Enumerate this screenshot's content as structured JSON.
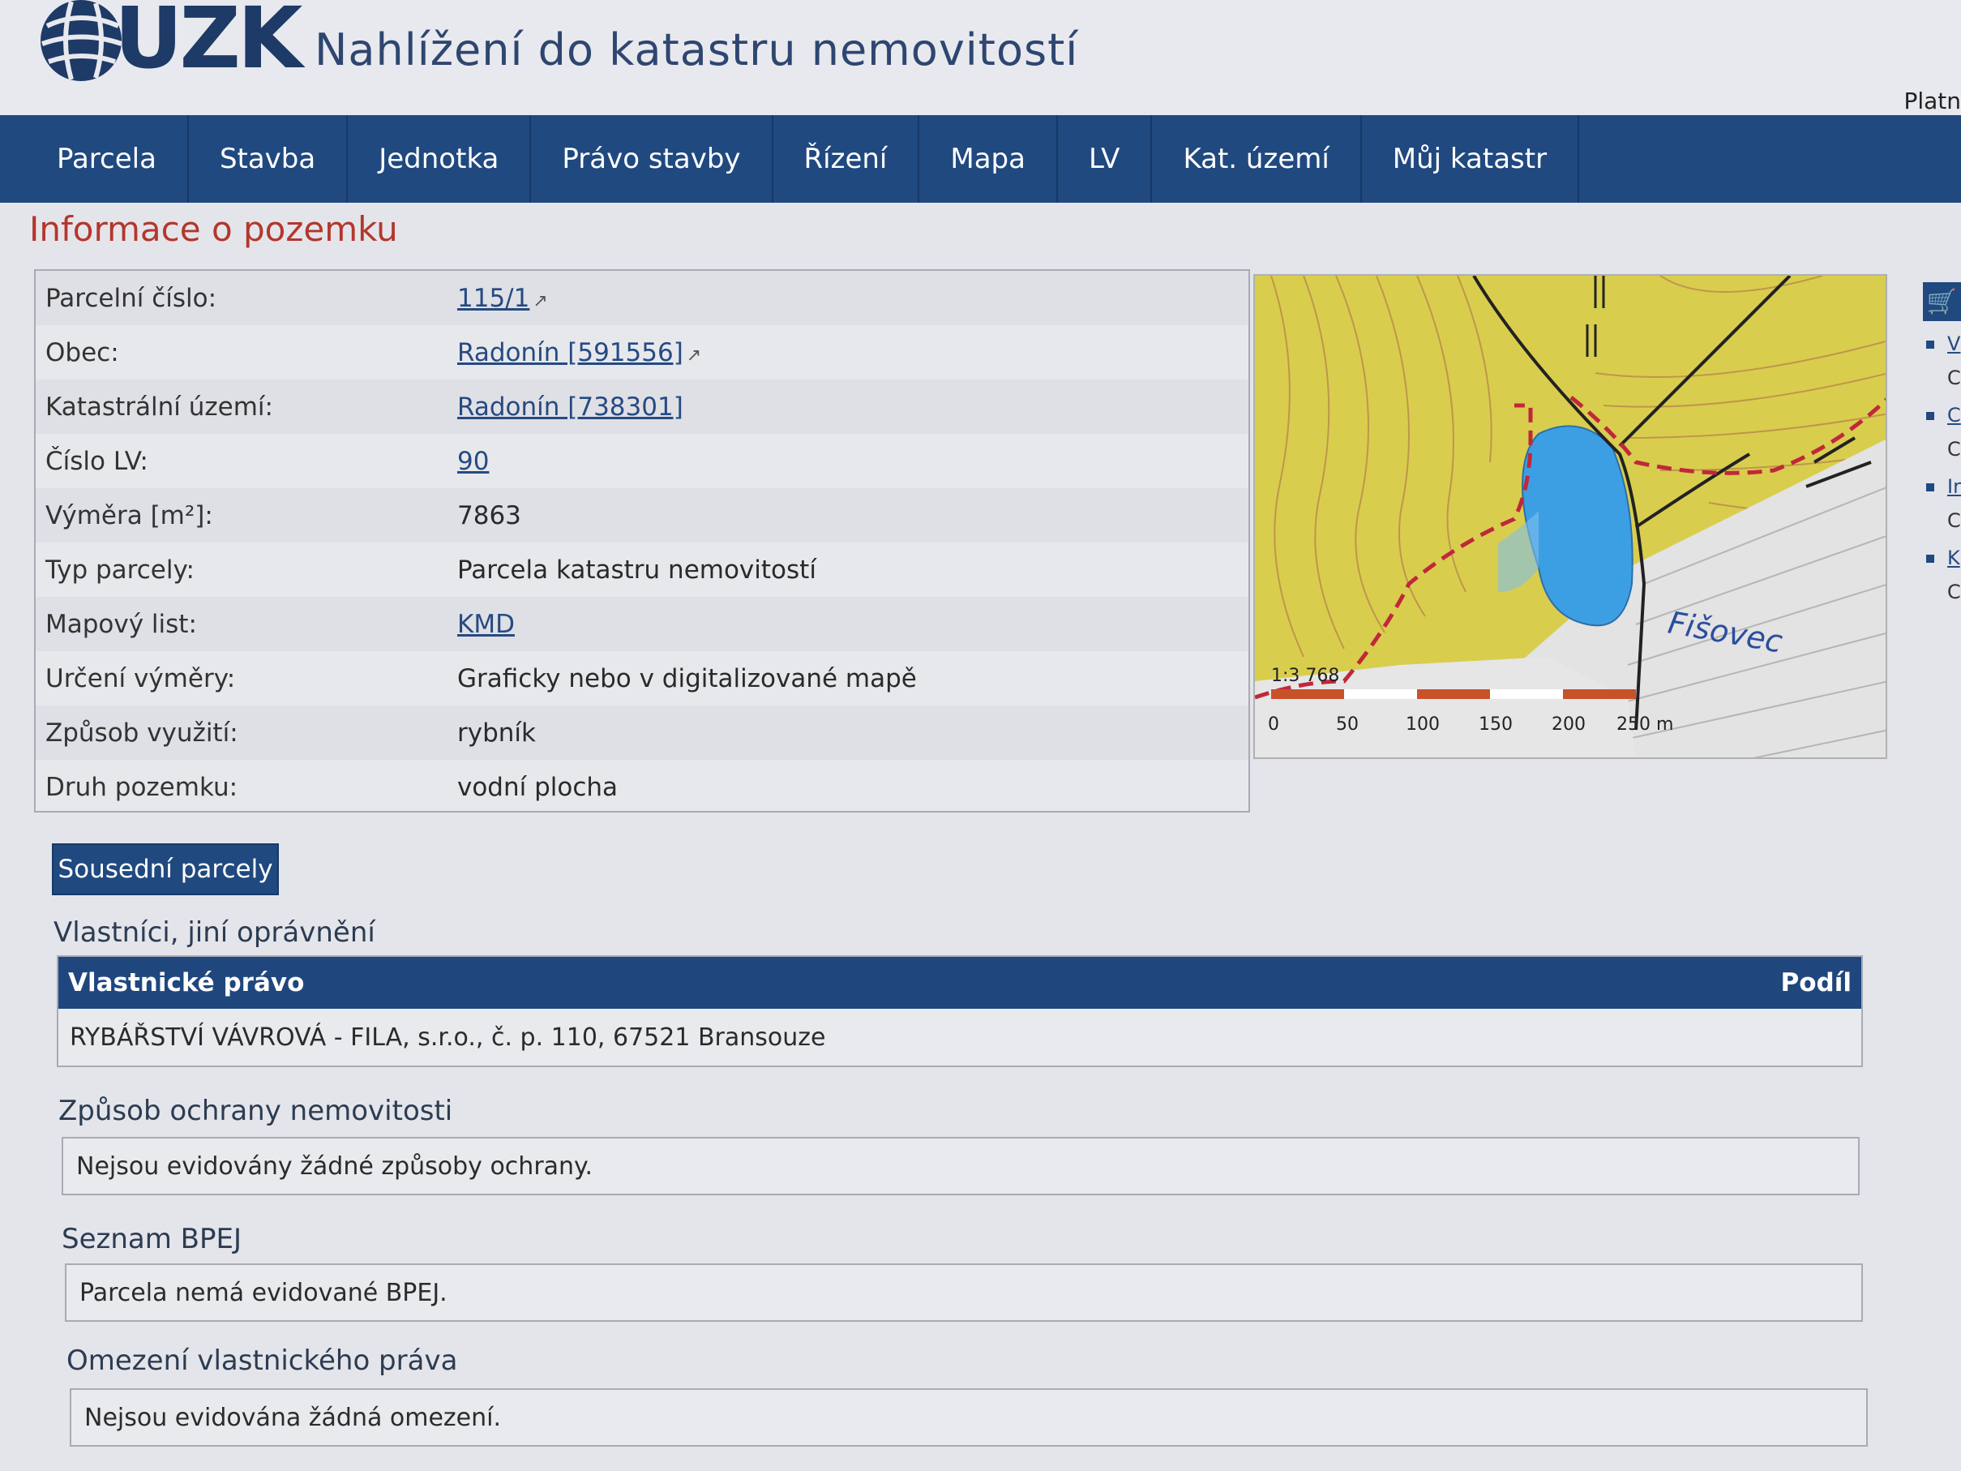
{
  "header": {
    "logo_text": "ÚZK",
    "app_title": "Nahlížení do katastru nemovitostí",
    "right_text": "Platn"
  },
  "nav": {
    "items": [
      "Parcela",
      "Stavba",
      "Jednotka",
      "Právo stavby",
      "Řízení",
      "Mapa",
      "LV",
      "Kat. území",
      "Můj katastr"
    ]
  },
  "section_title": "Informace o pozemku",
  "parcel": {
    "rows": [
      {
        "label": "Parcelní číslo:",
        "value": "115/1"
      },
      {
        "label": "Obec:",
        "value": "Radonín [591556]"
      },
      {
        "label": "Katastrální území:",
        "value": "Radonín [738301]"
      },
      {
        "label": "Číslo LV:",
        "value": "90"
      },
      {
        "label": "Výměra [m²]:",
        "value": "7863"
      },
      {
        "label": "Typ parcely:",
        "value": "Parcela katastru nemovitostí"
      },
      {
        "label": "Mapový list:",
        "value": "KMD"
      },
      {
        "label": "Určení výměry:",
        "value": "Graficky nebo v digitalizované mapě"
      },
      {
        "label": "Způsob využití:",
        "value": "rybník"
      },
      {
        "label": "Druh pozemku:",
        "value": "vodní plocha"
      }
    ]
  },
  "map": {
    "place_label": "Fišovec",
    "scale_ratio": "1:3 768",
    "scale_ticks": [
      "0",
      "50",
      "100",
      "150",
      "200",
      "250 m"
    ],
    "colors": {
      "field": "#d9cd4e",
      "water": "#3d9fe3",
      "forest": "#e3e3e3",
      "boundary": "#c0283a"
    }
  },
  "side": {
    "bullets": [
      {
        "a": "V",
        "b": "C"
      },
      {
        "a": "C",
        "b": "C"
      },
      {
        "a": "Ir",
        "b": "C"
      },
      {
        "a": "K",
        "b": "C"
      }
    ]
  },
  "neighbor_button": "Sousední parcely",
  "owners": {
    "title": "Vlastníci, jiní oprávnění",
    "col_right": "Vlastnické právo",
    "col_share": "Podíl",
    "rows": [
      "RYBÁŘSTVÍ VÁVROVÁ - FILA, s.r.o., č. p. 110, 67521 Bransouze"
    ]
  },
  "protection": {
    "title": "Způsob ochrany nemovitosti",
    "text": "Nejsou evidovány žádné způsoby ochrany."
  },
  "bpej": {
    "title": "Seznam BPEJ",
    "text": "Parcela nemá evidované BPEJ."
  },
  "restrictions": {
    "title": "Omezení vlastnického práva",
    "text": "Nejsou evidována žádná omezení."
  }
}
